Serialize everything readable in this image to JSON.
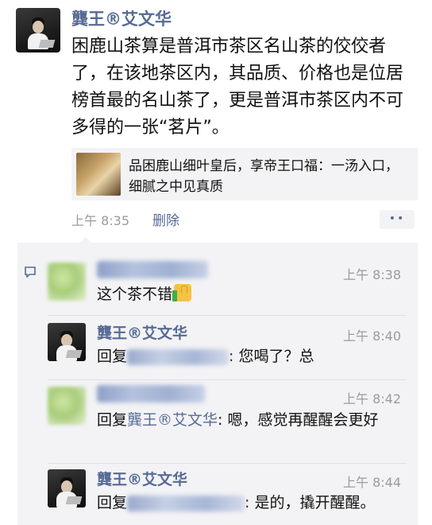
{
  "post": {
    "author": "龔王®艾文华",
    "text": "困鹿山茶算是普洱市茶区名山茶的佼佼者了，在该地茶区内，其品质、价格也是位居榜首最的名山茶了，更是普洱市茶区内不可多得的一张“茗片”。",
    "link_card": {
      "title": "品困鹿山细叶皇后，享帝王口福：一汤入口，细腻之中见真质",
      "thumb_icon": "tea-product-thumbnail"
    },
    "time": "上午 8:35",
    "delete_label": "删除",
    "more_label": "••"
  },
  "comments": [
    {
      "author": "",
      "author_blurred": true,
      "time": "上午 8:38",
      "text": "这个茶不错",
      "emoji": "thumbs-up"
    },
    {
      "author": "龔王®艾文华",
      "author_blurred": false,
      "time": "上午 8:40",
      "reply_prefix": "回复",
      "reply_to_blurred": true,
      "text": ": 您喝了？总"
    },
    {
      "author": "",
      "author_blurred": true,
      "time": "上午 8:42",
      "reply_prefix": "回复",
      "reply_to": "龔王®艾文华",
      "text": ": 嗯，感觉再醒醒会更好"
    },
    {
      "author": "龔王®艾文华",
      "author_blurred": false,
      "time": "上午 8:44",
      "reply_prefix": "回复",
      "reply_to_blurred": true,
      "text": ": 是的，撬开醒醒。"
    }
  ],
  "colors": {
    "link": "#576b95",
    "time": "#9b9b9b",
    "panel": "#f3f3f5"
  }
}
